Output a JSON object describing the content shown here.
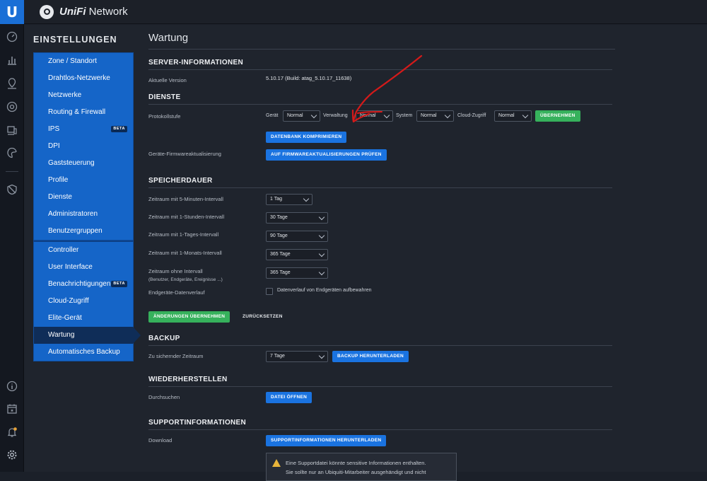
{
  "app": {
    "logo_letter": "U",
    "brand_prefix": "UniFi",
    "brand_suffix": "Network"
  },
  "iconbar": [
    "dashboard-icon",
    "statistics-icon",
    "map-icon",
    "devices-icon",
    "clients-icon",
    "insights-icon",
    "security-icon",
    "info-icon",
    "calendar-icon",
    "alerts-icon",
    "settings-icon"
  ],
  "settings_nav": {
    "title": "EINSTELLUNGEN",
    "group1": [
      {
        "label": "Zone / Standort"
      },
      {
        "label": "Drahtlos-Netzwerke"
      },
      {
        "label": "Netzwerke"
      },
      {
        "label": "Routing & Firewall"
      },
      {
        "label": "IPS",
        "badge": "BETA"
      },
      {
        "label": "DPI"
      },
      {
        "label": "Gaststeuerung"
      },
      {
        "label": "Profile"
      },
      {
        "label": "Dienste"
      },
      {
        "label": "Administratoren"
      },
      {
        "label": "Benutzergruppen"
      }
    ],
    "group2": [
      {
        "label": "Controller"
      },
      {
        "label": "User Interface"
      },
      {
        "label": "Benachrichtigungen",
        "badge": "BETA"
      },
      {
        "label": "Cloud-Zugriff"
      },
      {
        "label": "Elite-Gerät"
      },
      {
        "label": "Wartung",
        "active": true
      },
      {
        "label": "Automatisches Backup"
      }
    ]
  },
  "page": {
    "title": "Wartung",
    "server": {
      "heading": "SERVER-INFORMATIONEN",
      "version_label": "Aktuelle Version",
      "version_value": "5.10.17 (Build: atag_5.10.17_11638)"
    },
    "services": {
      "heading": "DIENSTE",
      "log_label": "Protokollstufe",
      "device_label": "Gerät",
      "device_value": "Normal",
      "management_label": "Verwaltung",
      "management_value": "Normal",
      "system_label": "System",
      "system_value": "Normal",
      "cloud_label": "Cloud-Zugriff",
      "cloud_value": "Normal",
      "apply_button": "ÜBERNEHMEN",
      "compact_db_button": "DATENBANK KOMPRIMIEREN",
      "firmware_label": "Geräte-Firmwareaktualisierung",
      "firmware_button": "AUF FIRMWAREAKTUALISIERUNGEN PRÜFEN"
    },
    "retention": {
      "heading": "SPEICHERDAUER",
      "rows": [
        {
          "label": "Zeitraum mit 5-Minuten-Intervall",
          "value": "1 Tag"
        },
        {
          "label": "Zeitraum mit 1-Stunden-Intervall",
          "value": "30 Tage"
        },
        {
          "label": "Zeitraum mit 1-Tages-Intervall",
          "value": "90 Tage"
        },
        {
          "label": "Zeitraum mit 1-Monats-Intervall",
          "value": "365 Tage"
        }
      ],
      "no_interval_label": "Zeitraum ohne Intervall",
      "no_interval_sub": "(Benutzer, Endgeräte, Ereignisse ...)",
      "no_interval_value": "365 Tage",
      "client_history_label": "Endgeräte-Datenverlauf",
      "client_history_checkbox": "Datenverlauf von Endgeräten aufbewahren",
      "save_button": "ÄNDERUNGEN ÜBERNEHMEN",
      "reset_button": "ZURÜCKSETZEN"
    },
    "backup": {
      "heading": "BACKUP",
      "period_label": "Zu sichernder Zeitraum",
      "period_value": "7 Tage",
      "download_button": "BACKUP HERUNTERLADEN"
    },
    "restore": {
      "heading": "WIEDERHERSTELLEN",
      "browse_label": "Durchsuchen",
      "open_button": "DATEI ÖFFNEN"
    },
    "support": {
      "heading": "SUPPORTINFORMATIONEN",
      "download_label": "Download",
      "download_button": "SUPPORTINFORMATIONEN HERUNTERLADEN",
      "warning_line1": "Eine Supportdatei könnte sensitive Informationen enthalten.",
      "warning_line2": "Sie sollte nur an Ubiquiti-Mitarbeiter ausgehändigt und nicht"
    }
  },
  "colors": {
    "accent": "#1a73e0",
    "nav_blue": "#1565c8",
    "green": "#36b15c",
    "annotation": "#d41a1a",
    "warning": "#e8b43a"
  }
}
